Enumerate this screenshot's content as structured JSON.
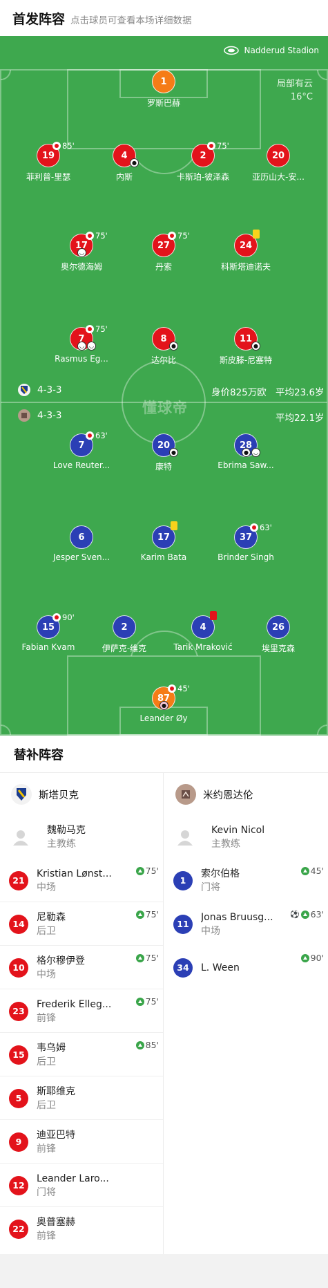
{
  "header": {
    "title": "首发阵容",
    "subtitle": "点击球员可查看本场详细数据"
  },
  "pitch": {
    "stadium": "Nadderud Stadion",
    "weather_desc": "局部有云",
    "weather_temp": "16°C",
    "watermark": "懂球帝",
    "home_formation": "4-3-3",
    "away_formation": "4-3-3",
    "home_value": "身价825万欧",
    "home_avg_age": "平均23.6岁",
    "away_avg_age": "平均22.1岁"
  },
  "home_players": [
    {
      "num": "1",
      "name": "罗斯巴赫"
    },
    {
      "num": "19",
      "name": "菲利普-里瑟",
      "sub": "85'"
    },
    {
      "num": "4",
      "name": "内斯"
    },
    {
      "num": "2",
      "name": "卡斯珀-彼泽森",
      "sub": "75'"
    },
    {
      "num": "20",
      "name": "亚历山大-安..."
    },
    {
      "num": "17",
      "name": "奥尔德海姆",
      "sub": "75'"
    },
    {
      "num": "27",
      "name": "丹索",
      "sub": "75'"
    },
    {
      "num": "24",
      "name": "科斯塔迪诺夫"
    },
    {
      "num": "7",
      "name": "Rasmus Eg...",
      "sub": "75'"
    },
    {
      "num": "8",
      "name": "达尔比"
    },
    {
      "num": "11",
      "name": "斯皮滕-尼塞特"
    }
  ],
  "away_players": [
    {
      "num": "7",
      "name": "Love Reuter...",
      "sub": "63'"
    },
    {
      "num": "20",
      "name": "康特"
    },
    {
      "num": "28",
      "name": "Ebrima Saw..."
    },
    {
      "num": "6",
      "name": "Jesper Sven..."
    },
    {
      "num": "17",
      "name": "Karim Bata"
    },
    {
      "num": "37",
      "name": "Brinder Singh",
      "sub": "63'"
    },
    {
      "num": "15",
      "name": "Fabian Kvam",
      "sub": "90'"
    },
    {
      "num": "2",
      "name": "伊萨克-维克"
    },
    {
      "num": "4",
      "name": "Tarik Mraković"
    },
    {
      "num": "26",
      "name": "埃里克森"
    },
    {
      "num": "87",
      "name": "Leander Øy",
      "sub": "45'"
    }
  ],
  "subs": {
    "title": "替补阵容",
    "home_team": "斯塔贝克",
    "away_team": "米约恩达伦",
    "home_coach": {
      "name": "魏勒马克",
      "role": "主教练"
    },
    "away_coach": {
      "name": "Kevin Nicol",
      "role": "主教练"
    },
    "home": [
      {
        "num": "21",
        "name": "Kristian Lønst...",
        "pos": "中场",
        "in": "75'"
      },
      {
        "num": "14",
        "name": "尼勒森",
        "pos": "后卫",
        "in": "75'"
      },
      {
        "num": "10",
        "name": "格尔穆伊登",
        "pos": "中场",
        "in": "75'"
      },
      {
        "num": "23",
        "name": "Frederik Elleg...",
        "pos": "前锋",
        "in": "75'"
      },
      {
        "num": "15",
        "name": "韦乌姆",
        "pos": "后卫",
        "in": "85'"
      },
      {
        "num": "5",
        "name": "斯耶维克",
        "pos": "后卫"
      },
      {
        "num": "9",
        "name": "迪亚巴特",
        "pos": "前锋"
      },
      {
        "num": "12",
        "name": "Leander Laro...",
        "pos": "门将"
      },
      {
        "num": "22",
        "name": "奥普塞赫",
        "pos": "前锋"
      }
    ],
    "away": [
      {
        "num": "1",
        "name": "索尔伯格",
        "pos": "门将",
        "in": "45'"
      },
      {
        "num": "11",
        "name": "Jonas Bruusg...",
        "pos": "中场",
        "in": "63'"
      },
      {
        "num": "34",
        "name": "L. Ween",
        "pos": "",
        "in": "90'"
      }
    ]
  },
  "colors": {
    "pitch": "#3ea84e",
    "home": "#e3131b",
    "away": "#2b3fb5",
    "keeper": "#f57c16"
  }
}
